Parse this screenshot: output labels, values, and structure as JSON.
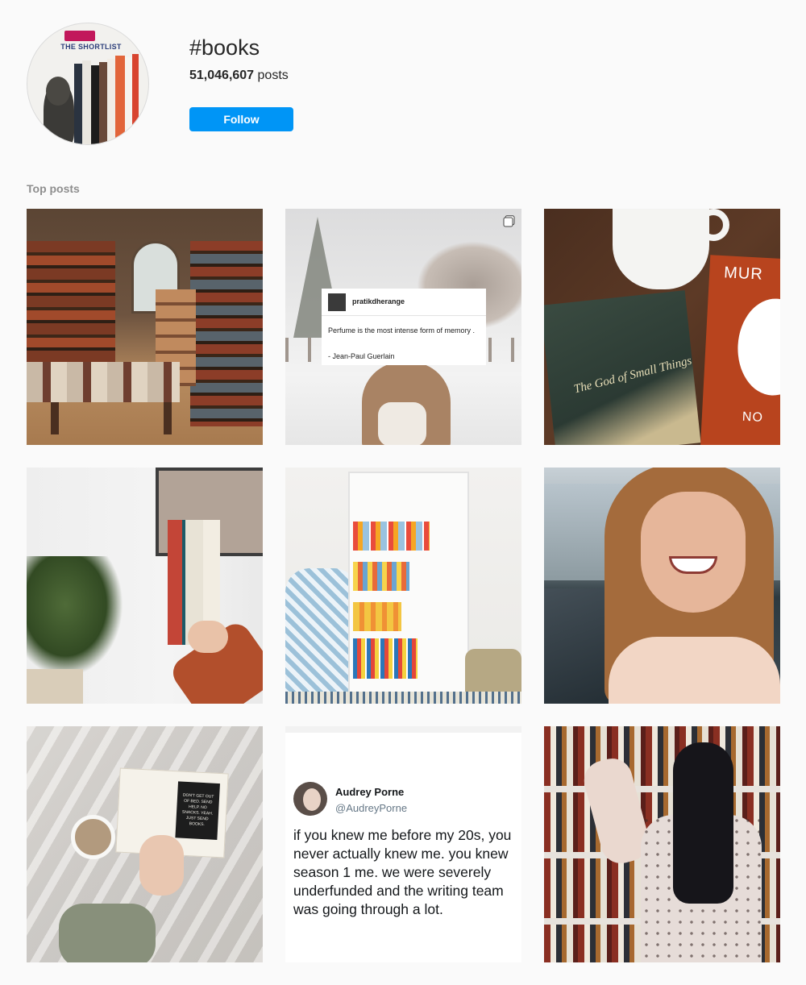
{
  "header": {
    "hashtag": "#books",
    "post_count": "51,046,607",
    "post_count_suffix": " posts",
    "follow_label": "Follow",
    "avatar_text": "THE SHORTLIST"
  },
  "section": {
    "label": "Top posts"
  },
  "posts": [
    {
      "alt": "bookshop interior"
    },
    {
      "alt": "snowy quote",
      "card_user": "pratikdherange",
      "card_quote": "Perfume is the most intense form of memory .",
      "card_author": "- Jean-Paul Guerlain"
    },
    {
      "alt": "books with coffee cup",
      "book_title": "The God of Small Things",
      "book2_top": "MUR",
      "book2_bottom": "NO"
    },
    {
      "alt": "hand holding books near plant"
    },
    {
      "alt": "white bookcase"
    },
    {
      "alt": "smiling selfie by the sea"
    },
    {
      "alt": "reading in bed",
      "card_text": "DON'T GET OUT OF BED. SEND HELP. NO SNACKS. YEAH. JUST SEND BOOKS."
    },
    {
      "alt": "tweet screenshot",
      "name": "Audrey Porne",
      "handle": "@AudreyPorne",
      "text": "if you knew me before my 20s, you never actually knew me. you knew season 1 me. we were severely underfunded and the writing team was going through a lot."
    },
    {
      "alt": "woman reaching for a book on shelves"
    }
  ],
  "colors": {
    "follow_button": "#0095f6",
    "background": "#fafafa",
    "muted_text": "#8e8e8e"
  }
}
